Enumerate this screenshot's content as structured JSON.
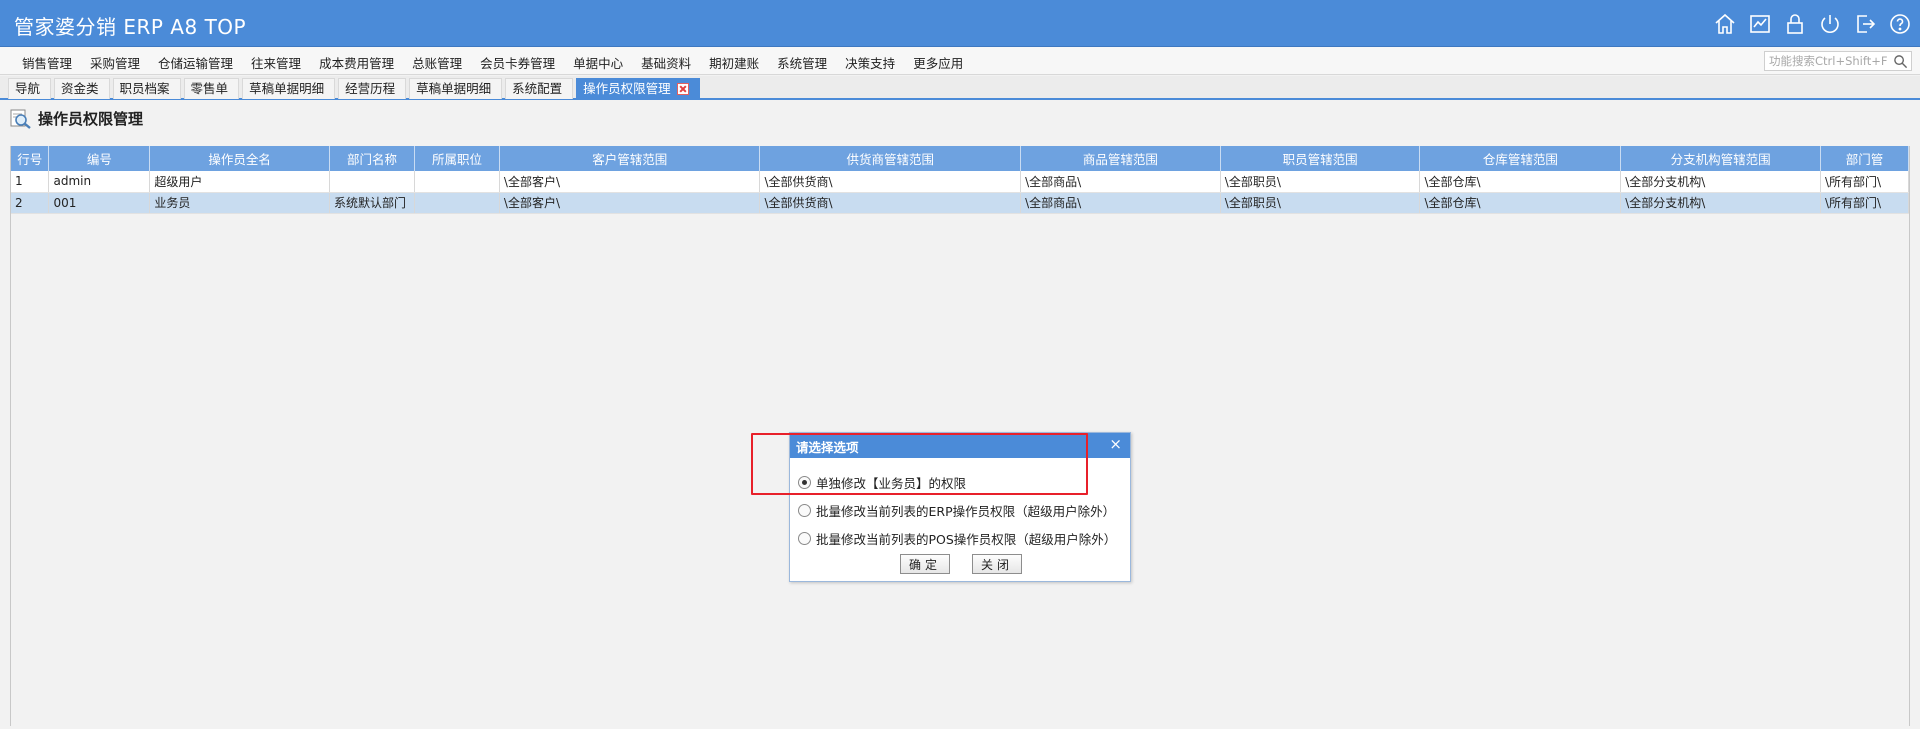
{
  "header": {
    "title": "管家婆分销 ERP A8 TOP",
    "icons": [
      "home-icon",
      "chart-icon",
      "lock-icon",
      "power-icon",
      "exit-icon",
      "help-icon"
    ]
  },
  "menu": {
    "items": [
      "销售管理",
      "采购管理",
      "仓储运输管理",
      "往来管理",
      "成本费用管理",
      "总账管理",
      "会员卡券管理",
      "单据中心",
      "基础资料",
      "期初建账",
      "系统管理",
      "决策支持",
      "更多应用"
    ],
    "search_placeholder": "功能搜索Ctrl+Shift+F"
  },
  "tabs": {
    "items": [
      "导航",
      "资金类",
      "职员档案",
      "零售单",
      "草稿单据明细",
      "经营历程",
      "草稿单据明细",
      "系统配置"
    ],
    "active": "操作员权限管理"
  },
  "page": {
    "title": "操作员权限管理"
  },
  "grid": {
    "columns": [
      "行号",
      "编号",
      "操作员全名",
      "部门名称",
      "所属职位",
      "客户管辖范围",
      "供货商管辖范围",
      "商品管辖范围",
      "职员管辖范围",
      "仓库管辖范围",
      "分支机构管辖范围",
      "部门管"
    ],
    "rows": [
      [
        "1",
        "admin",
        "超级用户",
        "",
        "",
        "\\全部客户\\",
        "\\全部供货商\\",
        "\\全部商品\\",
        "\\全部职员\\",
        "\\全部仓库\\",
        "\\全部分支机构\\",
        "\\所有部门\\"
      ],
      [
        "2",
        "001",
        "业务员",
        "系统默认部门",
        "",
        "\\全部客户\\",
        "\\全部供货商\\",
        "\\全部商品\\",
        "\\全部职员\\",
        "\\全部仓库\\",
        "\\全部分支机构\\",
        "\\所有部门\\"
      ]
    ],
    "selected_row": 2
  },
  "dialog": {
    "title": "请选择选项",
    "close": "×",
    "options": [
      {
        "label": "单独修改【业务员】的权限",
        "checked": true
      },
      {
        "label": "批量修改当前列表的ERP操作员权限（超级用户除外）",
        "checked": false
      },
      {
        "label": "批量修改当前列表的POS操作员权限（超级用户除外）",
        "checked": false
      }
    ],
    "ok_label": "确定",
    "close_label": "关闭"
  },
  "colors": {
    "header_blue": "#4b8bd8",
    "grid_header": "#6ea2e0",
    "selected_row": "#c8dcf0",
    "highlight_red": "#e8202a"
  }
}
